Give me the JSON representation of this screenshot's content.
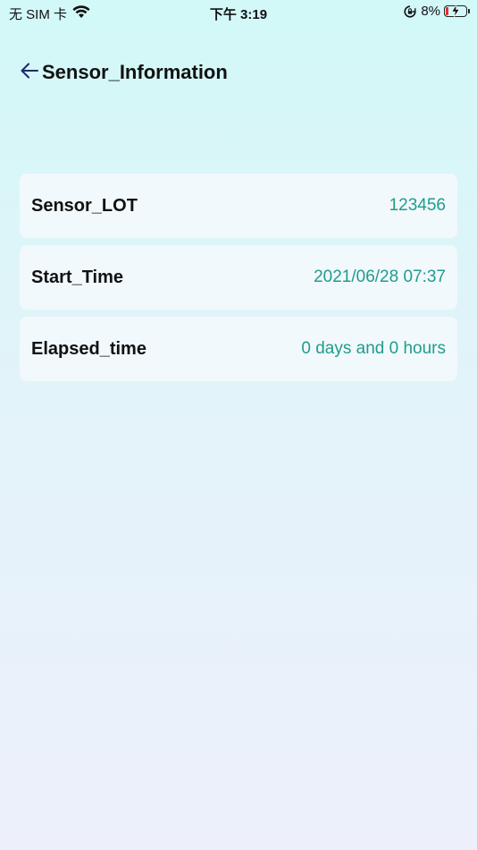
{
  "status_bar": {
    "carrier": "无 SIM 卡",
    "time": "下午 3:19",
    "battery_percent": "8%",
    "battery_level": 0.08,
    "icons": [
      "wifi-icon",
      "rotation-lock-icon",
      "battery-charging-icon"
    ]
  },
  "header": {
    "back_icon": "arrow-left-icon",
    "title": "Sensor_Information"
  },
  "info_rows": [
    {
      "label": "Sensor_LOT",
      "value": "123456"
    },
    {
      "label": "Start_Time",
      "value": "2021/06/28 07:37"
    },
    {
      "label": "Elapsed_time",
      "value": "0 days and 0 hours"
    }
  ],
  "colors": {
    "value_text": "#219b8d",
    "card_background": "#f1f9fc",
    "background_top": "#d2f8f8",
    "background_bottom": "#edf0fb",
    "back_arrow": "#1f2d6b"
  }
}
